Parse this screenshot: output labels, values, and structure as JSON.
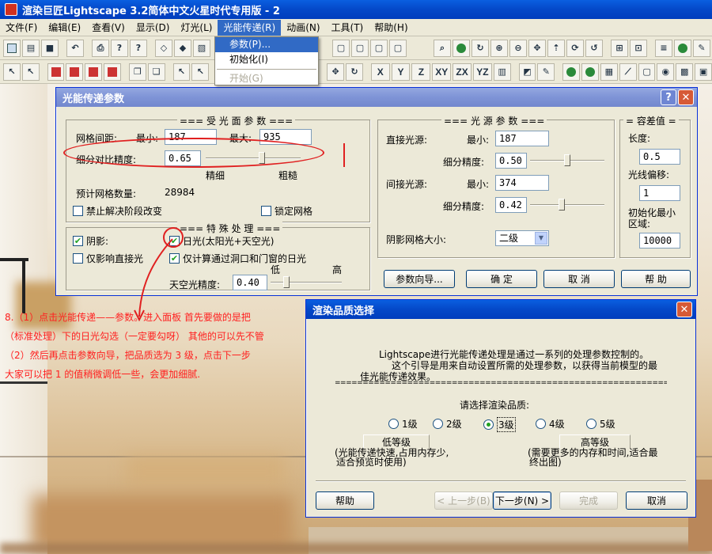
{
  "app": {
    "title": "渲染巨匠Lightscape 3.2简体中文火星时代专用版 - 2"
  },
  "menubar": {
    "items": [
      "文件(F)",
      "编辑(E)",
      "查看(V)",
      "显示(D)",
      "灯光(L)",
      "光能传递(R)",
      "动画(N)",
      "工具(T)",
      "帮助(H)"
    ],
    "active_index": 5
  },
  "toolbar2": {
    "axis_labels": [
      "X",
      "Y",
      "Z",
      "XY",
      "ZX",
      "YZ"
    ]
  },
  "dropdown": {
    "items": [
      "参数(P)...",
      "初始化(I)",
      "开始(G)"
    ]
  },
  "radiosity_dialog": {
    "title": "光能传递参数",
    "help_button": "?",
    "close_button": "✕",
    "receiver": {
      "group_title": "=== 受 光 面 参 数 ===",
      "mesh_spacing_label": "网格间距:",
      "min_label": "最小:",
      "min_value": "187",
      "max_label": "最大:",
      "max_value": "935",
      "subdivision_label": "细分对比精度:",
      "subdivision_value": "0.65",
      "slider_position": 0.6,
      "fine_label": "精细",
      "coarse_label": "粗糙",
      "estimate_label": "预计网格数量:",
      "estimate_value": "28984",
      "disable_stage_change": "禁止解决阶段改变",
      "lock_mesh": "锁定网格"
    },
    "special": {
      "group_title": "=== 特 殊 处 理 ===",
      "shadows": "阴影:",
      "shadows_checked": true,
      "daylight": "日光(太阳光+天空光)",
      "daylight_checked": true,
      "direct_only": "仅影响直接光",
      "direct_only_checked": false,
      "openings_only": "仅计算通过洞口和门窗的日光",
      "openings_only_checked": true,
      "low_label": "低",
      "high_label": "高",
      "sky_precision_label": "天空光精度:",
      "sky_precision_value": "0.40",
      "sky_slider_position": 0.2
    },
    "light_source": {
      "group_title": "=== 光 源 参 数 ===",
      "direct_label": "直接光源:",
      "direct_min_label": "最小:",
      "direct_min_value": "187",
      "direct_subdiv_label": "细分精度:",
      "direct_subdiv_value": "0.50",
      "direct_slider_position": 0.5,
      "indirect_label": "间接光源:",
      "indirect_min_label": "最小:",
      "indirect_min_value": "374",
      "indirect_subdiv_label": "细分精度:",
      "indirect_subdiv_value": "0.42",
      "indirect_slider_position": 0.42,
      "shadow_grid_label": "阴影网格大小:",
      "shadow_grid_value": "二级"
    },
    "tolerance": {
      "group_title": "= 容差值 =",
      "length_label": "长度:",
      "length_value": "0.5",
      "ray_offset_label": "光线偏移:",
      "ray_offset_value": "1",
      "init_min_label": "初始化最小",
      "init_min_label2": "区域:",
      "init_min_value": "10000"
    },
    "buttons": {
      "wizard": "参数向导...",
      "ok": "确 定",
      "cancel": "取 消",
      "help": "帮 助"
    }
  },
  "quality_dialog": {
    "title": "渲染品质选择",
    "close_button": "✕",
    "description_line1": "Lightscape进行光能传递处理是通过一系列的处理参数控制的。",
    "description_line2": "这个引导是用来自动设置所需的处理参数，以获得当前模型的最",
    "description_line3": "佳光能传递效果。",
    "divider": "======================================================================",
    "prompt": "请选择渲染品质:",
    "levels": [
      "1级",
      "2级",
      "3级",
      "4级",
      "5级"
    ],
    "selected_index": 2,
    "low_title": "低等级",
    "low_desc1": "(光能传递快速,占用内存少,",
    "low_desc2": "适合预览时使用)",
    "high_title": "高等级",
    "high_desc1": "(需要更多的内存和时间,适合最",
    "high_desc2": "终出图)",
    "buttons": {
      "help": "帮助",
      "prev": "< 上一步(B)",
      "next": "下一步(N) >",
      "finish": "完成",
      "cancel": "取消"
    }
  },
  "annotation": {
    "line1": "8.（1）点击光能传递——参数。进入面板 首先要做的是把",
    "line2": "（标准处理）下的日光勾选（一定要勾呀） 其他的可以先不管",
    "line3": "（2）然后再点击参数向导，把品质选为 3 级，点击下一步",
    "line4": "大家可以把 1 的值稍微调低一些，会更加细腻.",
    "color": "#ff2020"
  }
}
